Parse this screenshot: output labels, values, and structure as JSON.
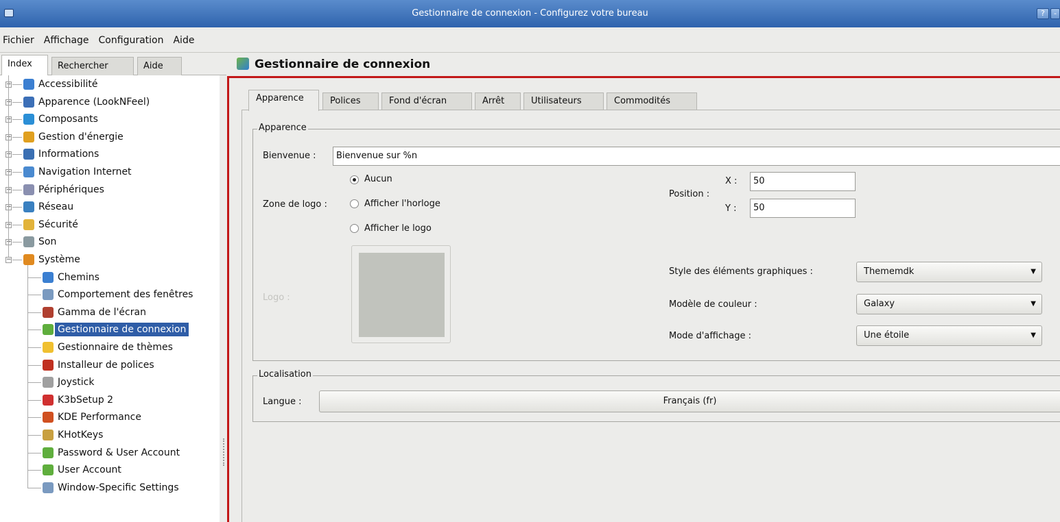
{
  "window": {
    "title": "Gestionnaire de connexion - Configurez votre bureau",
    "help_btn": "?",
    "min_btn": "-"
  },
  "menubar": [
    "Fichier",
    "Affichage",
    "Configuration",
    "Aide"
  ],
  "left_tabs": [
    "Index",
    "Rechercher",
    "Aide"
  ],
  "tree": {
    "top": [
      {
        "label": "Accessibilité",
        "icon": "accessibility-icon",
        "color": "#3b7fd1"
      },
      {
        "label": "Apparence (LookNFeel)",
        "icon": "appearance-icon",
        "color": "#3c6fb7"
      },
      {
        "label": "Composants",
        "icon": "components-icon",
        "color": "#2b8fd6"
      },
      {
        "label": "Gestion d'énergie",
        "icon": "power-icon",
        "color": "#e0a020"
      },
      {
        "label": "Informations",
        "icon": "info-icon",
        "color": "#3a6fb3"
      },
      {
        "label": "Navigation Internet",
        "icon": "internet-icon",
        "color": "#4a8ad0"
      },
      {
        "label": "Périphériques",
        "icon": "peripherals-icon",
        "color": "#8a8fb0"
      },
      {
        "label": "Réseau",
        "icon": "network-icon",
        "color": "#3a80c0"
      },
      {
        "label": "Sécurité",
        "icon": "security-icon",
        "color": "#e2b33a"
      },
      {
        "label": "Son",
        "icon": "sound-icon",
        "color": "#8a9aa0"
      },
      {
        "label": "Système",
        "icon": "system-icon",
        "color": "#e08a20"
      }
    ],
    "children": [
      {
        "label": "Chemins",
        "icon": "paths-icon",
        "color": "#3b7fd1"
      },
      {
        "label": "Comportement des fenêtres",
        "icon": "window-behavior-icon",
        "color": "#7a9ac0"
      },
      {
        "label": "Gamma de l'écran",
        "icon": "gamma-icon",
        "color": "#b04030"
      },
      {
        "label": "Gestionnaire de connexion",
        "icon": "login-manager-icon",
        "color": "#5fae3d",
        "selected": true
      },
      {
        "label": "Gestionnaire de thèmes",
        "icon": "themes-icon",
        "color": "#f0c030"
      },
      {
        "label": "Installeur de polices",
        "icon": "font-installer-icon",
        "color": "#c03020"
      },
      {
        "label": "Joystick",
        "icon": "joystick-icon",
        "color": "#a0a0a0"
      },
      {
        "label": "K3bSetup 2",
        "icon": "k3bsetup-icon",
        "color": "#d03030"
      },
      {
        "label": "KDE Performance",
        "icon": "performance-icon",
        "color": "#d05020"
      },
      {
        "label": "KHotKeys",
        "icon": "hotkeys-icon",
        "color": "#c8a040"
      },
      {
        "label": "Password & User Account",
        "icon": "password-icon",
        "color": "#5fae3d"
      },
      {
        "label": "User Account",
        "icon": "user-account-icon",
        "color": "#5fae3d"
      },
      {
        "label": "Window-Specific Settings",
        "icon": "window-settings-icon",
        "color": "#7a9ac0"
      }
    ]
  },
  "panel": {
    "title": "Gestionnaire de connexion",
    "tabs": [
      "Apparence",
      "Polices",
      "Fond d'écran",
      "Arrêt",
      "Utilisateurs",
      "Commodités"
    ],
    "appearance": {
      "group": "Apparence",
      "welcome_label": "Bienvenue :",
      "welcome_value": "Bienvenue sur %n",
      "logo_zone_label": "Zone de logo :",
      "radio_none": "Aucun",
      "radio_clock": "Afficher l'horloge",
      "radio_logo": "Afficher le logo",
      "position_label": "Position :",
      "x_label": "X :",
      "x_value": "50",
      "y_label": "Y :",
      "y_value": "50",
      "logo_label": "Logo :",
      "style_label": "Style des éléments graphiques :",
      "style_value": "Thememdk",
      "color_label": "Modèle de couleur :",
      "color_value": "Galaxy",
      "display_label": "Mode d'affichage :",
      "display_value": "Une étoile"
    },
    "localisation": {
      "group": "Localisation",
      "lang_label": "Langue :",
      "lang_value": "Français (fr)"
    }
  }
}
